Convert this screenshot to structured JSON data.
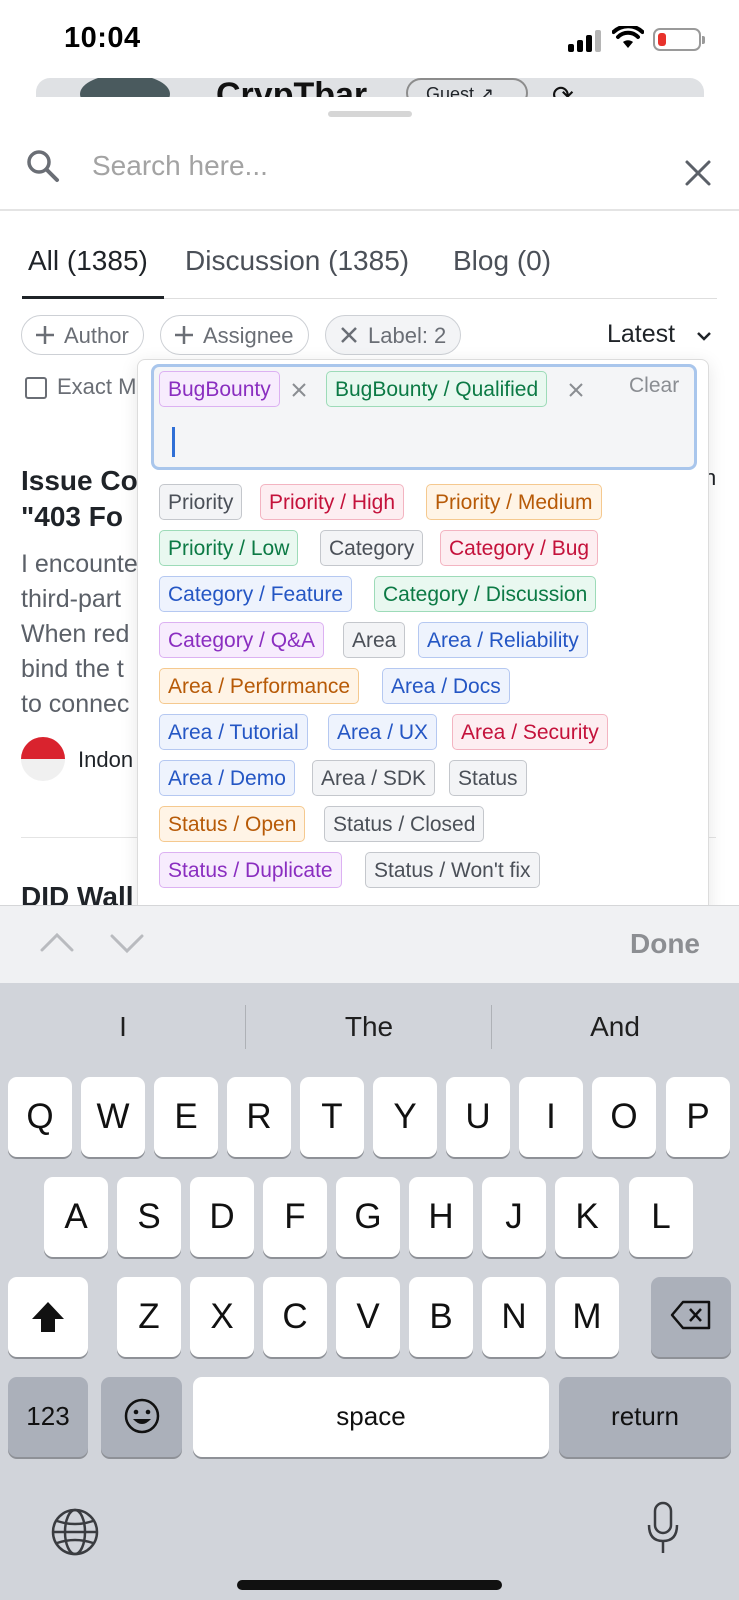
{
  "status_bar": {
    "time": "10:04"
  },
  "behind": {
    "title": "CrypTbar",
    "guest_label": "Guest ↗"
  },
  "search": {
    "placeholder": "Search here..."
  },
  "tabs": [
    {
      "label": "All (1385)",
      "active": true
    },
    {
      "label": "Discussion (1385)",
      "active": false
    },
    {
      "label": "Blog (0)",
      "active": false
    }
  ],
  "filters": {
    "author_label": "Author",
    "assignee_label": "Assignee",
    "label_filter": "Label: 2",
    "sort_label": "Latest",
    "exact_match_label": "Exact M"
  },
  "post": {
    "title_lines": "Issue Co\n\"403 Fo",
    "body_lines": "I encounte\nthird-part\nWhen red\nbind the t\nto connec",
    "author": "Indon",
    "edge_letter": "n"
  },
  "post2": {
    "title": "DID Wall"
  },
  "label_picker": {
    "selected": [
      {
        "label": "BugBounty",
        "color": "purple"
      },
      {
        "label": "BugBounty / Qualified",
        "color": "green"
      }
    ],
    "clear_label": "Clear",
    "options": [
      {
        "label": "Priority",
        "color": "gray"
      },
      {
        "label": "Priority / High",
        "color": "red"
      },
      {
        "label": "Priority / Medium",
        "color": "orange"
      },
      {
        "label": "Priority / Low",
        "color": "green"
      },
      {
        "label": "Category",
        "color": "gray"
      },
      {
        "label": "Category / Bug",
        "color": "red"
      },
      {
        "label": "Category / Feature",
        "color": "blue"
      },
      {
        "label": "Category / Discussion",
        "color": "green"
      },
      {
        "label": "Category / Q&A",
        "color": "purple"
      },
      {
        "label": "Area",
        "color": "gray"
      },
      {
        "label": "Area / Reliability",
        "color": "blue"
      },
      {
        "label": "Area / Performance",
        "color": "orange"
      },
      {
        "label": "Area / Docs",
        "color": "blue"
      },
      {
        "label": "Area / Tutorial",
        "color": "blue"
      },
      {
        "label": "Area / UX",
        "color": "blue"
      },
      {
        "label": "Area / Security",
        "color": "red"
      },
      {
        "label": "Area / Demo",
        "color": "blue"
      },
      {
        "label": "Area / SDK",
        "color": "gray"
      },
      {
        "label": "Status",
        "color": "gray"
      },
      {
        "label": "Status / Open",
        "color": "orange"
      },
      {
        "label": "Status / Closed",
        "color": "gray"
      },
      {
        "label": "Status / Duplicate",
        "color": "purple"
      },
      {
        "label": "Status / Won't fix",
        "color": "gray"
      }
    ]
  },
  "accessory": {
    "done_label": "Done"
  },
  "keyboard": {
    "suggestions": [
      "I",
      "The",
      "And"
    ],
    "row1": [
      "Q",
      "W",
      "E",
      "R",
      "T",
      "Y",
      "U",
      "I",
      "O",
      "P"
    ],
    "row2": [
      "A",
      "S",
      "D",
      "F",
      "G",
      "H",
      "J",
      "K",
      "L"
    ],
    "row3": [
      "Z",
      "X",
      "C",
      "V",
      "B",
      "N",
      "M"
    ],
    "numbers_label": "123",
    "space_label": "space",
    "return_label": "return"
  },
  "colors": {
    "accent": "#2f6fd6",
    "keyboard_bg": "#d1d4da"
  }
}
